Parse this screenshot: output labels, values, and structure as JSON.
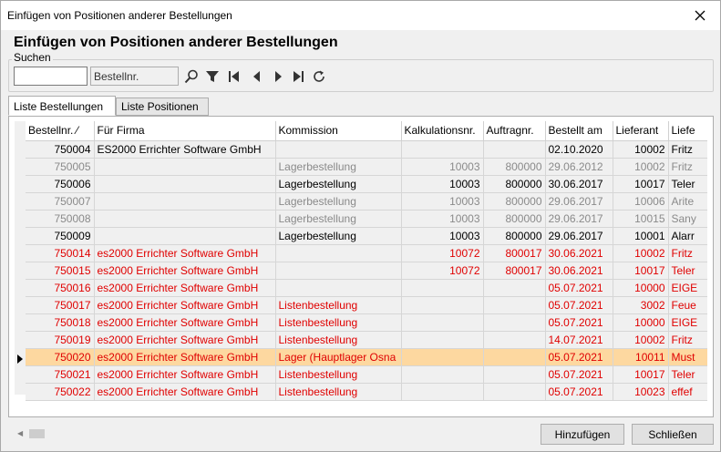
{
  "window": {
    "title": "Einfügen von Positionen anderer Bestellungen"
  },
  "heading": "Einfügen von Positionen anderer Bestellungen",
  "search": {
    "legend": "Suchen",
    "value": "",
    "field": "Bestellnr."
  },
  "tabs": [
    {
      "label": "Liste Bestellungen",
      "active": true
    },
    {
      "label": "Liste Positionen",
      "active": false
    }
  ],
  "columns": [
    "Bestellnr. ⁄",
    "Für Firma",
    "Kommission",
    "Kalkulationsnr.",
    "Auftragnr.",
    "Bestellt am",
    "Lieferant",
    "Liefe"
  ],
  "rows": [
    {
      "status": "black",
      "cells": [
        "750004",
        "ES2000 Errichter Software GmbH",
        "",
        "",
        "",
        "02.10.2020",
        "10002",
        "Fritz"
      ]
    },
    {
      "status": "gray",
      "cells": [
        "750005",
        "",
        "Lagerbestellung",
        "10003",
        "800000",
        "29.06.2012",
        "10002",
        "Fritz"
      ]
    },
    {
      "status": "black",
      "cells": [
        "750006",
        "",
        "Lagerbestellung",
        "10003",
        "800000",
        "30.06.2017",
        "10017",
        "Teler"
      ]
    },
    {
      "status": "gray",
      "cells": [
        "750007",
        "",
        "Lagerbestellung",
        "10003",
        "800000",
        "29.06.2017",
        "10006",
        "Arite"
      ]
    },
    {
      "status": "gray",
      "cells": [
        "750008",
        "",
        "Lagerbestellung",
        "10003",
        "800000",
        "29.06.2017",
        "10015",
        "Sany"
      ]
    },
    {
      "status": "black",
      "cells": [
        "750009",
        "",
        "Lagerbestellung",
        "10003",
        "800000",
        "29.06.2017",
        "10001",
        "Alarr"
      ]
    },
    {
      "status": "red",
      "cells": [
        "750014",
        "es2000 Errichter Software GmbH",
        "",
        "10072",
        "800017",
        "30.06.2021",
        "10002",
        "Fritz"
      ]
    },
    {
      "status": "red",
      "cells": [
        "750015",
        "es2000 Errichter Software GmbH",
        "",
        "10072",
        "800017",
        "30.06.2021",
        "10017",
        "Teler"
      ]
    },
    {
      "status": "red",
      "cells": [
        "750016",
        "es2000 Errichter Software GmbH",
        "",
        "",
        "",
        "05.07.2021",
        "10000",
        "EIGE"
      ]
    },
    {
      "status": "red",
      "cells": [
        "750017",
        "es2000 Errichter Software GmbH",
        "Listenbestellung",
        "",
        "",
        "05.07.2021",
        "3002",
        "Feue"
      ]
    },
    {
      "status": "red",
      "cells": [
        "750018",
        "es2000 Errichter Software GmbH",
        "Listenbestellung",
        "",
        "",
        "05.07.2021",
        "10000",
        "EIGE"
      ]
    },
    {
      "status": "red",
      "cells": [
        "750019",
        "es2000 Errichter Software GmbH",
        "Listenbestellung",
        "",
        "",
        "14.07.2021",
        "10002",
        "Fritz"
      ]
    },
    {
      "status": "red",
      "selected": true,
      "cells": [
        "750020",
        "es2000 Errichter Software GmbH",
        "Lager (Hauptlager Osna",
        "",
        "",
        "05.07.2021",
        "10011",
        "Must"
      ]
    },
    {
      "status": "red",
      "cells": [
        "750021",
        "es2000 Errichter Software GmbH",
        "Listenbestellung",
        "",
        "",
        "05.07.2021",
        "10017",
        "Teler"
      ]
    },
    {
      "status": "red",
      "cells": [
        "750022",
        "es2000 Errichter Software GmbH",
        "Listenbestellung",
        "",
        "",
        "05.07.2021",
        "10023",
        "effef"
      ]
    }
  ],
  "buttons": {
    "add": "Hinzufügen",
    "close": "Schließen"
  },
  "colors": {
    "selected_row": "#fdd8a0",
    "red_text": "#e00000",
    "gray_text": "#8a8a8a"
  }
}
